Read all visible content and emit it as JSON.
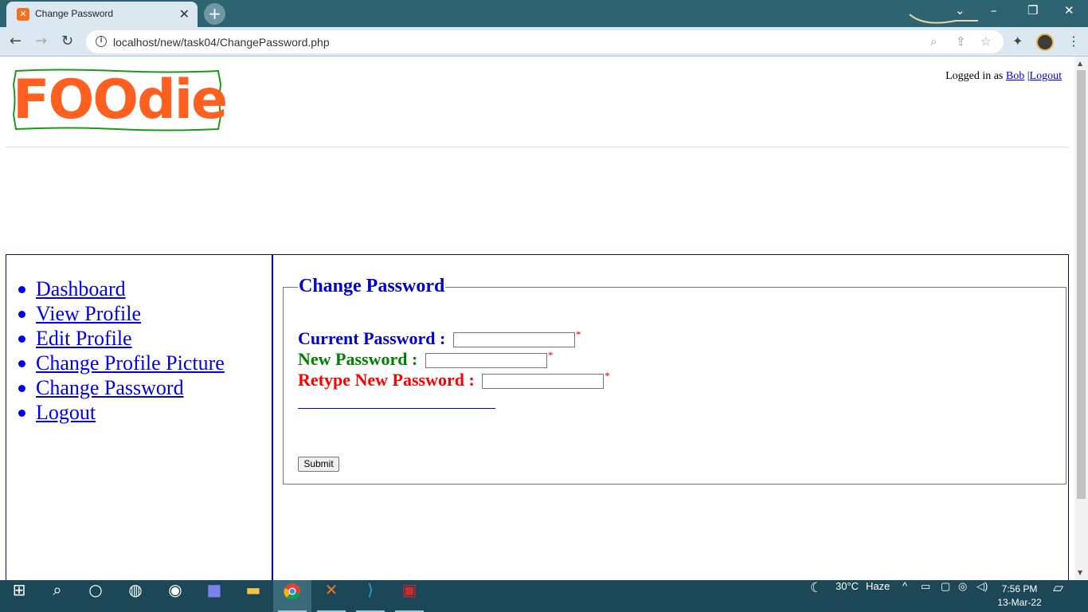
{
  "browser": {
    "tab_title": "Change Password",
    "url": "localhost/new/task04/ChangePassword.php"
  },
  "header": {
    "logo_text": "FOOdie",
    "logged_in_prefix": "Logged in as",
    "username": "Bob",
    "separator": "|",
    "logout_link": "Logout"
  },
  "sidebar": {
    "items": [
      {
        "label": "Dashboard"
      },
      {
        "label": "View Profile"
      },
      {
        "label": "Edit Profile"
      },
      {
        "label": "Change Profile Picture"
      },
      {
        "label": "Change Password"
      },
      {
        "label": "Logout"
      }
    ]
  },
  "form": {
    "legend": "Change Password",
    "fields": [
      {
        "label": "Current Password :",
        "color": "#0000cd",
        "value": ""
      },
      {
        "label": "New Password :",
        "color": "#008000",
        "value": ""
      },
      {
        "label": "Retype New Password :",
        "color": "#ff0000",
        "value": ""
      }
    ],
    "required_mark": "*",
    "submit_label": "Submit"
  },
  "taskbar": {
    "weather_temp": "30°C",
    "weather_desc": "Haze",
    "time": "7:56 PM",
    "date": "13-Mar-22"
  }
}
